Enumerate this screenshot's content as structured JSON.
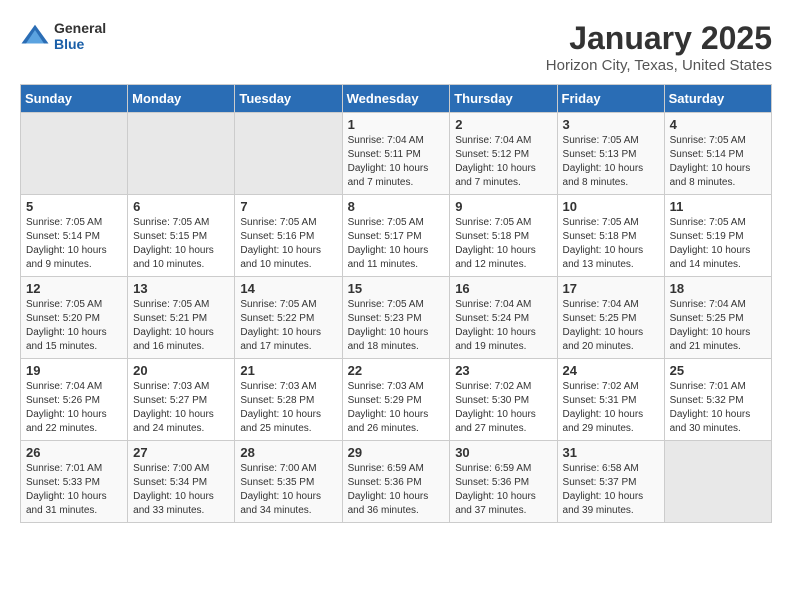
{
  "header": {
    "logo_general": "General",
    "logo_blue": "Blue",
    "title": "January 2025",
    "subtitle": "Horizon City, Texas, United States"
  },
  "days_of_week": [
    "Sunday",
    "Monday",
    "Tuesday",
    "Wednesday",
    "Thursday",
    "Friday",
    "Saturday"
  ],
  "weeks": [
    [
      {
        "day": "",
        "info": ""
      },
      {
        "day": "",
        "info": ""
      },
      {
        "day": "",
        "info": ""
      },
      {
        "day": "1",
        "info": "Sunrise: 7:04 AM\nSunset: 5:11 PM\nDaylight: 10 hours\nand 7 minutes."
      },
      {
        "day": "2",
        "info": "Sunrise: 7:04 AM\nSunset: 5:12 PM\nDaylight: 10 hours\nand 7 minutes."
      },
      {
        "day": "3",
        "info": "Sunrise: 7:05 AM\nSunset: 5:13 PM\nDaylight: 10 hours\nand 8 minutes."
      },
      {
        "day": "4",
        "info": "Sunrise: 7:05 AM\nSunset: 5:14 PM\nDaylight: 10 hours\nand 8 minutes."
      }
    ],
    [
      {
        "day": "5",
        "info": "Sunrise: 7:05 AM\nSunset: 5:14 PM\nDaylight: 10 hours\nand 9 minutes."
      },
      {
        "day": "6",
        "info": "Sunrise: 7:05 AM\nSunset: 5:15 PM\nDaylight: 10 hours\nand 10 minutes."
      },
      {
        "day": "7",
        "info": "Sunrise: 7:05 AM\nSunset: 5:16 PM\nDaylight: 10 hours\nand 10 minutes."
      },
      {
        "day": "8",
        "info": "Sunrise: 7:05 AM\nSunset: 5:17 PM\nDaylight: 10 hours\nand 11 minutes."
      },
      {
        "day": "9",
        "info": "Sunrise: 7:05 AM\nSunset: 5:18 PM\nDaylight: 10 hours\nand 12 minutes."
      },
      {
        "day": "10",
        "info": "Sunrise: 7:05 AM\nSunset: 5:18 PM\nDaylight: 10 hours\nand 13 minutes."
      },
      {
        "day": "11",
        "info": "Sunrise: 7:05 AM\nSunset: 5:19 PM\nDaylight: 10 hours\nand 14 minutes."
      }
    ],
    [
      {
        "day": "12",
        "info": "Sunrise: 7:05 AM\nSunset: 5:20 PM\nDaylight: 10 hours\nand 15 minutes."
      },
      {
        "day": "13",
        "info": "Sunrise: 7:05 AM\nSunset: 5:21 PM\nDaylight: 10 hours\nand 16 minutes."
      },
      {
        "day": "14",
        "info": "Sunrise: 7:05 AM\nSunset: 5:22 PM\nDaylight: 10 hours\nand 17 minutes."
      },
      {
        "day": "15",
        "info": "Sunrise: 7:05 AM\nSunset: 5:23 PM\nDaylight: 10 hours\nand 18 minutes."
      },
      {
        "day": "16",
        "info": "Sunrise: 7:04 AM\nSunset: 5:24 PM\nDaylight: 10 hours\nand 19 minutes."
      },
      {
        "day": "17",
        "info": "Sunrise: 7:04 AM\nSunset: 5:25 PM\nDaylight: 10 hours\nand 20 minutes."
      },
      {
        "day": "18",
        "info": "Sunrise: 7:04 AM\nSunset: 5:25 PM\nDaylight: 10 hours\nand 21 minutes."
      }
    ],
    [
      {
        "day": "19",
        "info": "Sunrise: 7:04 AM\nSunset: 5:26 PM\nDaylight: 10 hours\nand 22 minutes."
      },
      {
        "day": "20",
        "info": "Sunrise: 7:03 AM\nSunset: 5:27 PM\nDaylight: 10 hours\nand 24 minutes."
      },
      {
        "day": "21",
        "info": "Sunrise: 7:03 AM\nSunset: 5:28 PM\nDaylight: 10 hours\nand 25 minutes."
      },
      {
        "day": "22",
        "info": "Sunrise: 7:03 AM\nSunset: 5:29 PM\nDaylight: 10 hours\nand 26 minutes."
      },
      {
        "day": "23",
        "info": "Sunrise: 7:02 AM\nSunset: 5:30 PM\nDaylight: 10 hours\nand 27 minutes."
      },
      {
        "day": "24",
        "info": "Sunrise: 7:02 AM\nSunset: 5:31 PM\nDaylight: 10 hours\nand 29 minutes."
      },
      {
        "day": "25",
        "info": "Sunrise: 7:01 AM\nSunset: 5:32 PM\nDaylight: 10 hours\nand 30 minutes."
      }
    ],
    [
      {
        "day": "26",
        "info": "Sunrise: 7:01 AM\nSunset: 5:33 PM\nDaylight: 10 hours\nand 31 minutes."
      },
      {
        "day": "27",
        "info": "Sunrise: 7:00 AM\nSunset: 5:34 PM\nDaylight: 10 hours\nand 33 minutes."
      },
      {
        "day": "28",
        "info": "Sunrise: 7:00 AM\nSunset: 5:35 PM\nDaylight: 10 hours\nand 34 minutes."
      },
      {
        "day": "29",
        "info": "Sunrise: 6:59 AM\nSunset: 5:36 PM\nDaylight: 10 hours\nand 36 minutes."
      },
      {
        "day": "30",
        "info": "Sunrise: 6:59 AM\nSunset: 5:36 PM\nDaylight: 10 hours\nand 37 minutes."
      },
      {
        "day": "31",
        "info": "Sunrise: 6:58 AM\nSunset: 5:37 PM\nDaylight: 10 hours\nand 39 minutes."
      },
      {
        "day": "",
        "info": ""
      }
    ]
  ]
}
